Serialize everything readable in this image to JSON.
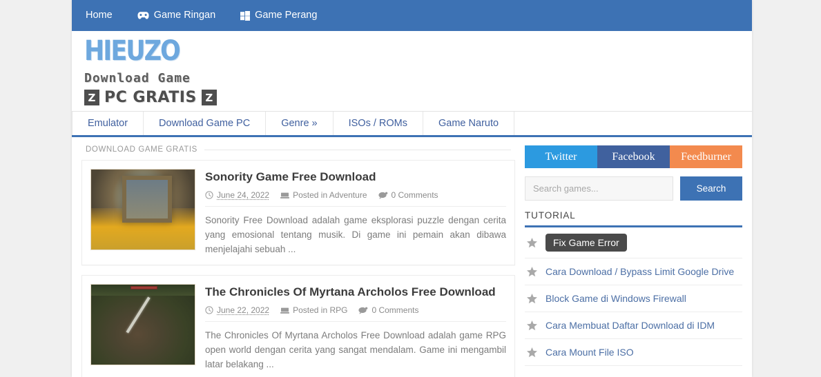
{
  "topnav": {
    "items": [
      {
        "label": "Home",
        "icon": "none"
      },
      {
        "label": "Game Ringan",
        "icon": "gamepad-icon"
      },
      {
        "label": "Game Perang",
        "icon": "windows-icon"
      }
    ],
    "background": "#3d72b4"
  },
  "logo": {
    "wordmark": "HIEUZO",
    "line2": "Download  Game",
    "badge": "Z",
    "line3": "PC GRATIS",
    "accent": "#6ea8de"
  },
  "menu": {
    "items": [
      {
        "label": "Emulator"
      },
      {
        "label": "Download Game PC"
      },
      {
        "label": "Genre »"
      },
      {
        "label": "ISOs / ROMs"
      },
      {
        "label": "Game Naruto"
      }
    ],
    "link_color": "#40609f",
    "underline_color": "#3d72b4"
  },
  "main": {
    "section_title": "DOWNLOAD GAME GRATIS",
    "posts": [
      {
        "title": "Sonority Game Free Download",
        "date": "June 24, 2022",
        "category": "Posted in Adventure",
        "comments": "0 Comments",
        "excerpt": "Sonority Free Download adalah game eksplorasi puzzle dengan cerita yang emosional tentang musik. Di game ini pemain akan dibawa menjelajahi sebuah ...",
        "thumb_style": "thumb-a"
      },
      {
        "title": "The Chronicles Of Myrtana Archolos Free Download",
        "date": "June 22, 2022",
        "category": "Posted in RPG",
        "comments": "0 Comments",
        "excerpt": "The Chronicles Of Myrtana Archolos Free Download adalah game RPG open world dengan cerita yang sangat mendalam. Game ini mengambil latar belakang ...",
        "thumb_style": "thumb-b"
      }
    ]
  },
  "sidebar": {
    "social": [
      {
        "label": "Twitter",
        "color": "#2c9ae0"
      },
      {
        "label": "Facebook",
        "color": "#40619e"
      },
      {
        "label": "Feedburner",
        "color": "#f38a4e"
      }
    ],
    "search": {
      "placeholder": "Search games...",
      "value": "",
      "button_label": "Search"
    },
    "tutorial": {
      "title": "TUTORIAL",
      "items": [
        {
          "label": "Fix Game Error",
          "active": true
        },
        {
          "label": "Cara Download / Bypass Limit Google Drive",
          "active": false
        },
        {
          "label": "Block Game di Windows Firewall",
          "active": false
        },
        {
          "label": "Cara Membuat Daftar Download di IDM",
          "active": false
        },
        {
          "label": "Cara Mount File ISO",
          "active": false
        }
      ]
    }
  }
}
